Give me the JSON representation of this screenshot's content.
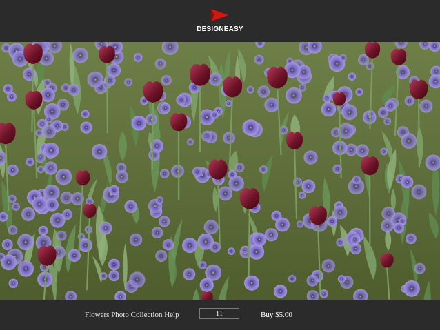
{
  "header": {
    "logo_icon": "red-triangle-flag-icon",
    "logo_text": "DESIGNEASY",
    "logo_color": "#cc1a14"
  },
  "photo": {
    "subject": "tulips-and-pansies-photo"
  },
  "footer": {
    "title": "Flowers Photo Collection Help",
    "page_number": "11",
    "buy_label": "Buy $5.00"
  },
  "colors": {
    "background": "#2b2b2b",
    "text": "#e6e6e6"
  }
}
